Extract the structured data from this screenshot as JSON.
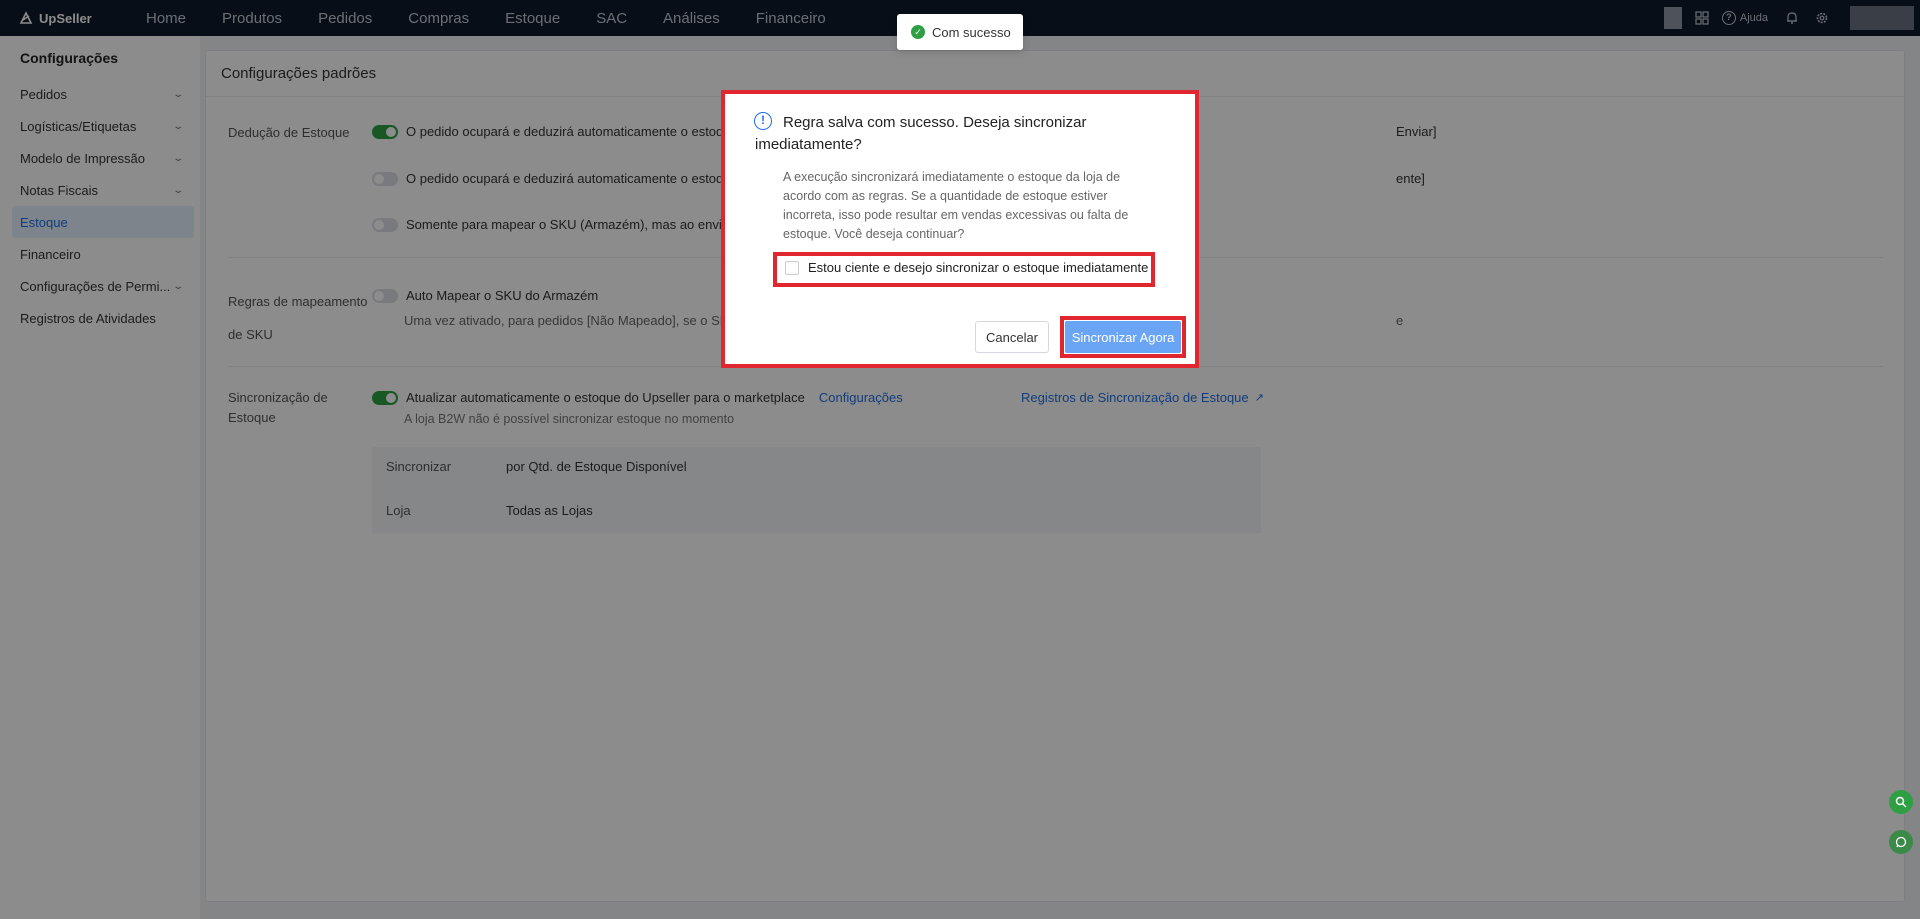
{
  "topbar": {
    "brand": "UpSeller",
    "nav": [
      "Home",
      "Produtos",
      "Pedidos",
      "Compras",
      "Estoque",
      "SAC",
      "Análises",
      "Financeiro"
    ],
    "help_label": "Ajuda"
  },
  "sidebar": {
    "title": "Configurações",
    "items": [
      {
        "label": "Pedidos",
        "expandable": true
      },
      {
        "label": "Logísticas/Etiquetas",
        "expandable": true
      },
      {
        "label": "Modelo de Impressão",
        "expandable": true
      },
      {
        "label": "Notas Fiscais",
        "expandable": true
      },
      {
        "label": "Estoque",
        "active": true
      },
      {
        "label": "Financeiro"
      },
      {
        "label": "Configurações de Permi...",
        "expandable": true
      },
      {
        "label": "Registros de Atividades"
      }
    ]
  },
  "main": {
    "title": "Configurações padrões",
    "deducao": {
      "label": "Dedução de Estoque",
      "options": [
        {
          "text": "O pedido ocupará e deduzirá automaticamente o estoque",
          "tail": "Enviar]",
          "on": true
        },
        {
          "text": "O pedido ocupará e deduzirá automaticamente o estoque",
          "tail": "ente]",
          "on": false
        },
        {
          "text": "Somente para mapear o SKU (Armazém), mas ao enviar",
          "tail": "",
          "on": false
        }
      ]
    },
    "mapeamento": {
      "label_line1": "Regras de mapeamento",
      "label_line2": "de SKU",
      "toggle_text": "Auto Mapear o SKU do Armazém",
      "description": "Uma vez ativado, para pedidos [Não Mapeado], se o SKU",
      "tail": "e"
    },
    "sincronizacao": {
      "label_line1": "Sincronização de",
      "label_line2": "Estoque",
      "toggle_text": "Atualizar automaticamente o estoque do Upseller para o marketplace",
      "config_link": "Configurações",
      "records_link": "Registros de Sincronização de Estoque",
      "note": "A loja B2W não é possível sincronizar estoque no momento",
      "info": [
        {
          "key": "Sincronizar",
          "value": "por Qtd. de Estoque Disponível"
        },
        {
          "key": "Loja",
          "value": "Todas as Lojas"
        }
      ]
    }
  },
  "toast": {
    "message": "Com sucesso"
  },
  "modal": {
    "title": "Regra salva com sucesso. Deseja sincronizar imediatamente?",
    "description": "A execução sincronizará imediatamente o estoque da loja de acordo com as regras. Se a quantidade de estoque estiver incorreta, isso pode resultar em vendas excessivas ou falta de estoque. Você deseja continuar?",
    "checkbox_label": "Estou ciente e desejo sincronizar o estoque imediatamente",
    "cancel_label": "Cancelar",
    "confirm_label": "Sincronizar Agora"
  },
  "colors": {
    "primary": "#1f6fe5",
    "success": "#2ea043",
    "highlight": "#e0262e",
    "topbar": "#0f1a2d"
  }
}
